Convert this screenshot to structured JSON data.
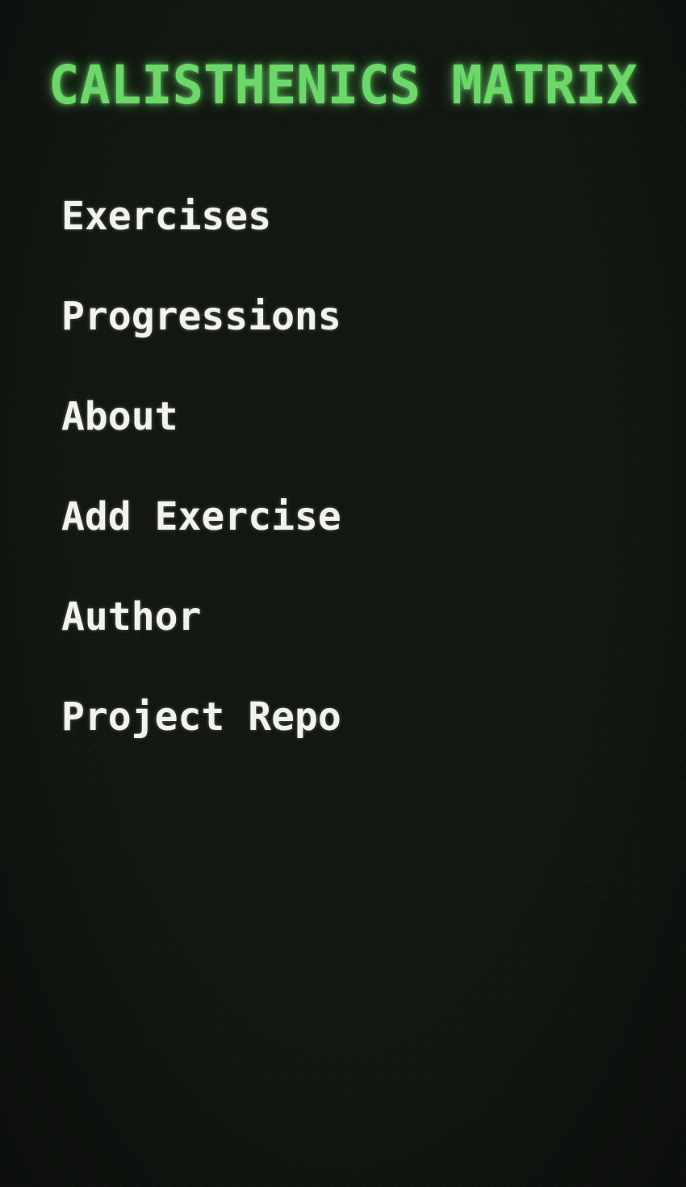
{
  "header": {
    "title": "CALISTHENICS MATRIX"
  },
  "nav": {
    "items": [
      {
        "label": "Exercises"
      },
      {
        "label": "Progressions"
      },
      {
        "label": "About"
      },
      {
        "label": "Add Exercise"
      },
      {
        "label": "Author"
      },
      {
        "label": "Project Repo"
      }
    ]
  },
  "colors": {
    "background": "#121711",
    "title_accent": "#6cd86a",
    "nav_text": "#f2f2ee"
  }
}
